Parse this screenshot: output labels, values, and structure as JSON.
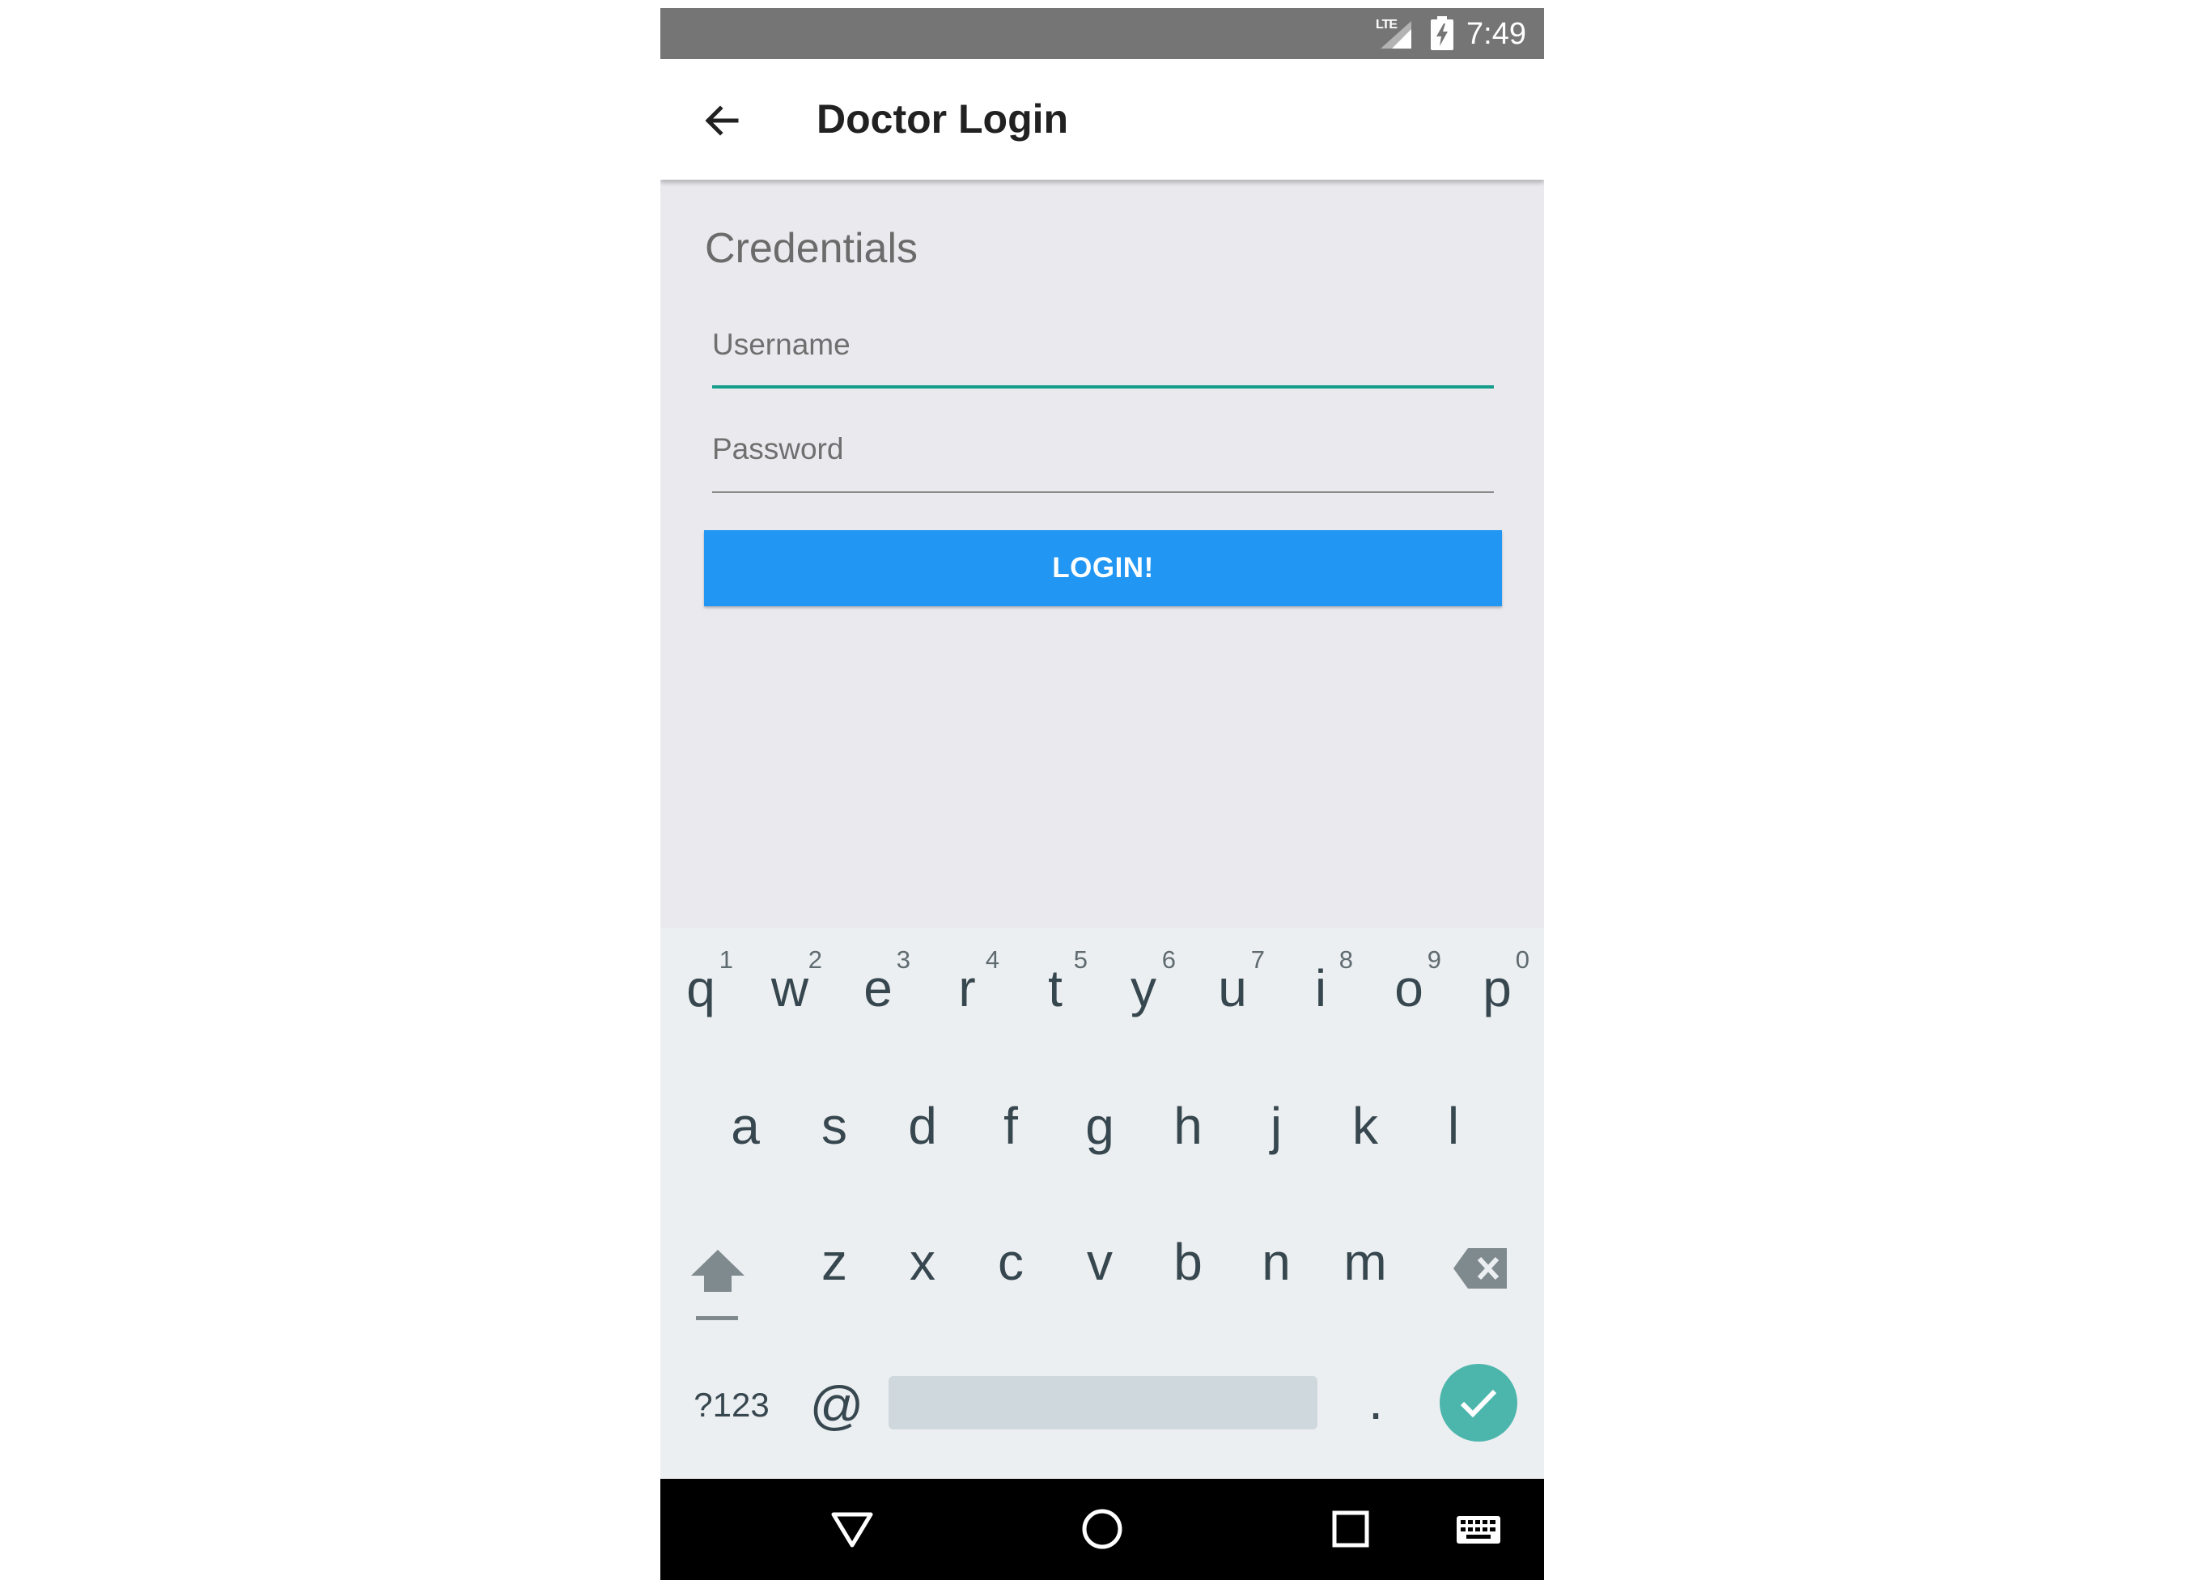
{
  "status_bar": {
    "network": "LTE",
    "time": "7:49"
  },
  "app_bar": {
    "title": "Doctor Login"
  },
  "form": {
    "section_title": "Credentials",
    "username_placeholder": "Username",
    "password_placeholder": "Password",
    "login_label": "LOGIN!"
  },
  "keyboard": {
    "row1": [
      {
        "key": "q",
        "hint": "1"
      },
      {
        "key": "w",
        "hint": "2"
      },
      {
        "key": "e",
        "hint": "3"
      },
      {
        "key": "r",
        "hint": "4"
      },
      {
        "key": "t",
        "hint": "5"
      },
      {
        "key": "y",
        "hint": "6"
      },
      {
        "key": "u",
        "hint": "7"
      },
      {
        "key": "i",
        "hint": "8"
      },
      {
        "key": "o",
        "hint": "9"
      },
      {
        "key": "p",
        "hint": "0"
      }
    ],
    "row2": [
      "a",
      "s",
      "d",
      "f",
      "g",
      "h",
      "j",
      "k",
      "l"
    ],
    "row3": [
      "z",
      "x",
      "c",
      "v",
      "b",
      "n",
      "m"
    ],
    "symbols_label": "?123",
    "at_label": "@",
    "period_label": ".",
    "icons": {
      "shift": "shift-icon",
      "backspace": "backspace-icon",
      "enter": "checkmark-icon"
    },
    "enter_color": "#4db6ac"
  },
  "nav_bar": {
    "icons": [
      "back-triangle-icon",
      "home-circle-icon",
      "recents-square-icon",
      "keyboard-icon"
    ]
  },
  "colors": {
    "accent": "#159e8c",
    "primary_button": "#2196f3",
    "status_bar": "#757575"
  }
}
